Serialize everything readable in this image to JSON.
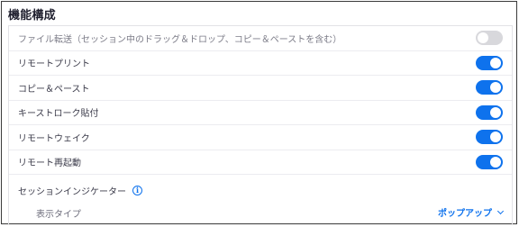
{
  "section": {
    "title": "機能構成"
  },
  "rows": [
    {
      "label": "ファイル転送（セッション中のドラッグ＆ドロップ、コピー＆ペーストを含む）",
      "enabled": false,
      "disabled": true
    },
    {
      "label": "リモートプリント",
      "enabled": true
    },
    {
      "label": "コピー＆ペースト",
      "enabled": true
    },
    {
      "label": "キーストローク貼付",
      "enabled": true
    },
    {
      "label": "リモートウェイク",
      "enabled": true
    },
    {
      "label": "リモート再起動",
      "enabled": true
    }
  ],
  "indicator": {
    "title": "セッションインジケーター",
    "info_icon": "info-icon",
    "display_type_label": "表示タイプ",
    "display_type_value": "ポップアップ"
  },
  "colors": {
    "accent": "#0e72ed",
    "toggle_off": "#d8d8dc"
  }
}
